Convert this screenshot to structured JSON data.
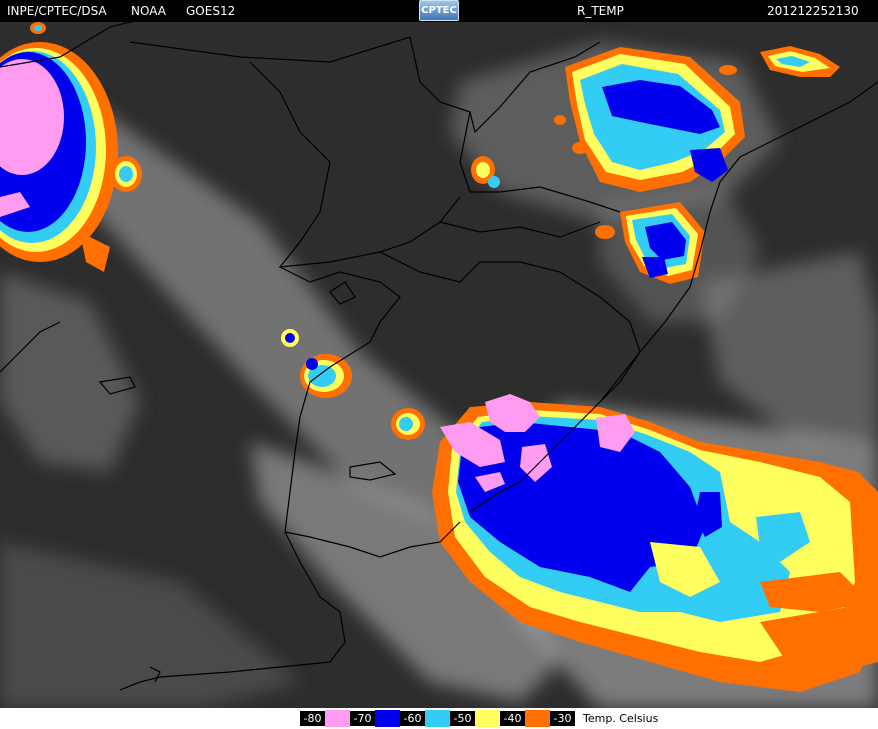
{
  "header": {
    "source": "INPE/CPTEC/DSA",
    "satellite_agency": "NOAA",
    "satellite": "GOES12",
    "logo_text": "CPTEC",
    "product": "R_TEMP",
    "timestamp": "201212252130"
  },
  "legend": {
    "entries": [
      {
        "label": "-80",
        "color": "#ff9cf2"
      },
      {
        "label": "-70",
        "color": "#0000ee"
      },
      {
        "label": "-60",
        "color": "#33ccf5"
      },
      {
        "label": "-50",
        "color": "#ffff60"
      },
      {
        "label": "-40",
        "color": "#ff7000"
      },
      {
        "label": "-30",
        "color": ""
      }
    ],
    "unit": "Temp. Celsius"
  },
  "colors": {
    "background": "#2d2d2d",
    "cloud": "#9a9a9a",
    "border_lines": "#000000"
  }
}
